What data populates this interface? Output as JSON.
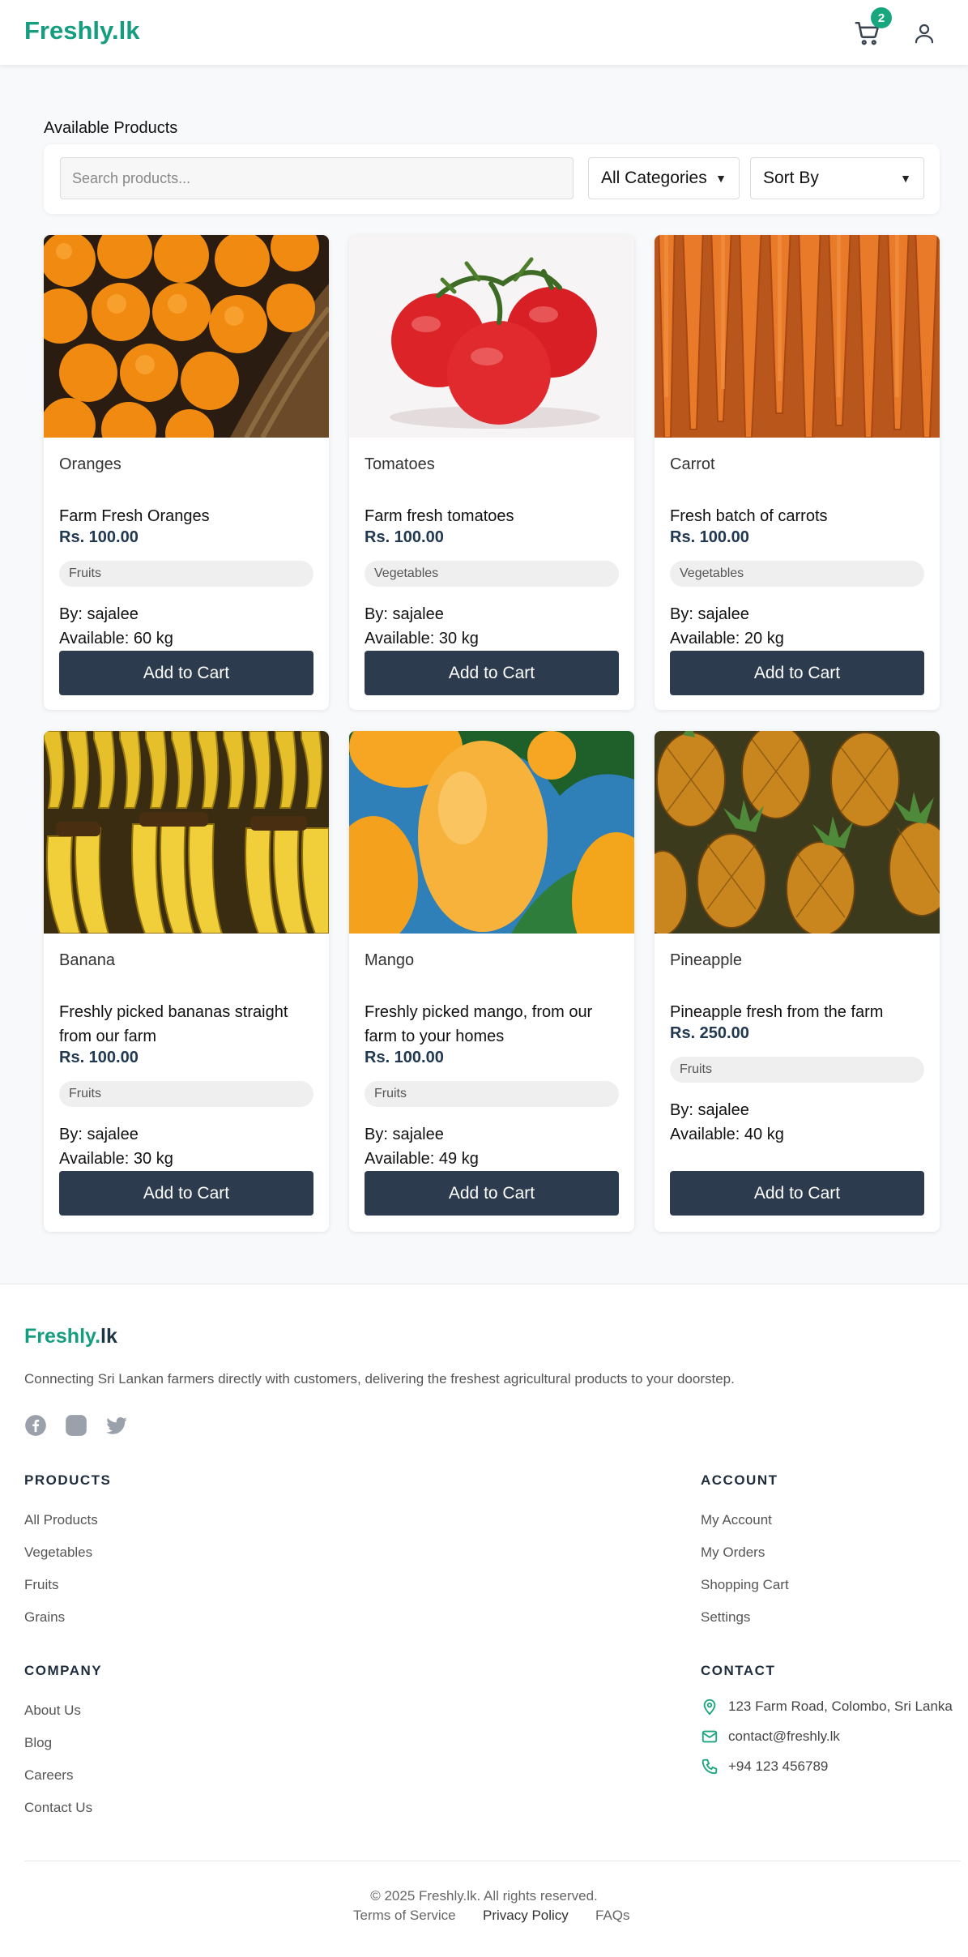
{
  "header": {
    "logo": "Freshly.lk",
    "cart_count": "2"
  },
  "main": {
    "title": "Available Products",
    "search_placeholder": "Search products...",
    "category_select": "All Categories",
    "sort_select": "Sort By"
  },
  "products": [
    {
      "name": "Oranges",
      "desc": "Farm Fresh Oranges",
      "price": "Rs. 100.00",
      "category": "Fruits",
      "seller": "By: sajalee",
      "available": "Available: 60 kg",
      "button": "Add to Cart",
      "image": "oranges"
    },
    {
      "name": "Tomatoes",
      "desc": "Farm fresh tomatoes",
      "price": "Rs. 100.00",
      "category": "Vegetables",
      "seller": "By: sajalee",
      "available": "Available: 30 kg",
      "button": "Add to Cart",
      "image": "tomatoes"
    },
    {
      "name": "Carrot",
      "desc": "Fresh batch of carrots",
      "price": "Rs. 100.00",
      "category": "Vegetables",
      "seller": "By: sajalee",
      "available": "Available: 20 kg",
      "button": "Add to Cart",
      "image": "carrots"
    },
    {
      "name": "Banana",
      "desc": "Freshly picked bananas straight from our farm",
      "price": "Rs. 100.00",
      "category": "Fruits",
      "seller": "By: sajalee",
      "available": "Available: 30 kg",
      "button": "Add to Cart",
      "image": "bananas"
    },
    {
      "name": "Mango",
      "desc": "Freshly picked mango, from our farm to your homes",
      "price": "Rs. 100.00",
      "category": "Fruits",
      "seller": "By: sajalee",
      "available": "Available: 49 kg",
      "button": "Add to Cart",
      "image": "mangoes"
    },
    {
      "name": "Pineapple",
      "desc": "Pineapple fresh from the farm",
      "price": "Rs. 250.00",
      "category": "Fruits",
      "seller": "By: sajalee",
      "available": "Available: 40 kg",
      "button": "Add to Cart",
      "image": "pineapples"
    }
  ],
  "footer": {
    "logo_a": "Freshly.",
    "logo_b": "lk",
    "tagline": "Connecting Sri Lankan farmers directly with customers, delivering the freshest agricultural products to your doorstep.",
    "social": [
      "facebook-icon",
      "instagram-icon",
      "twitter-icon"
    ],
    "products_heading": "PRODUCTS",
    "products_links": [
      "All Products",
      "Vegetables",
      "Fruits",
      "Grains"
    ],
    "account_heading": "ACCOUNT",
    "account_links": [
      "My Account",
      "My Orders",
      "Shopping Cart",
      "Settings"
    ],
    "company_heading": "COMPANY",
    "company_links": [
      "About Us",
      "Blog",
      "Careers",
      "Contact Us"
    ],
    "contact_heading": "CONTACT",
    "contact": {
      "address": "123 Farm Road, Colombo, Sri Lanka",
      "email": "contact@freshly.lk",
      "phone": "+94 123 456789"
    },
    "copyright": "© 2025 Freshly.lk. All rights reserved.",
    "legal": [
      "Terms of Service",
      "Privacy Policy",
      "FAQs"
    ]
  },
  "colors": {
    "brand": "#159d7f",
    "button": "#2d3b4e",
    "price": "#213851"
  }
}
